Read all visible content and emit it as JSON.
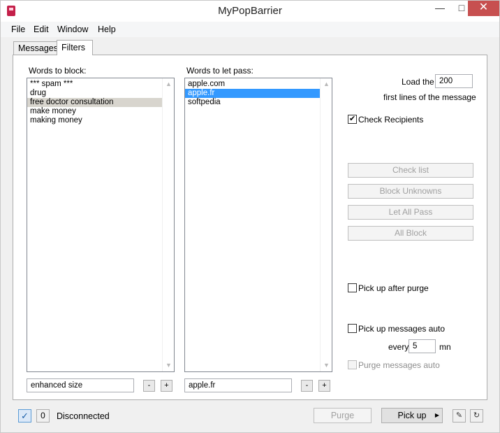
{
  "window": {
    "title": "MyPopBarrier"
  },
  "menu": {
    "file": "File",
    "edit": "Edit",
    "window": "Window",
    "help": "Help"
  },
  "tabs": {
    "messages": "Messages",
    "filters": "Filters",
    "active": "Filters"
  },
  "block": {
    "label": "Words to block:",
    "items": [
      "*** spam ***",
      "drug",
      "free doctor consultation",
      "make money",
      "making money"
    ],
    "selected_index": 2,
    "input_value": "enhanced size",
    "minus": "-",
    "plus": "+"
  },
  "pass": {
    "label": "Words to let pass:",
    "items": [
      "apple.com",
      "apple.fr",
      "softpedia"
    ],
    "selected_index": 1,
    "input_value": "apple.fr",
    "minus": "-",
    "plus": "+"
  },
  "options": {
    "load_the": "Load the",
    "load_lines": "200",
    "first_lines": "first lines of the message",
    "check_recipients": "Check Recipients",
    "check_recipients_checked": true,
    "check_list": "Check list",
    "block_unknowns": "Block Unknowns",
    "let_all_pass": "Let All Pass",
    "all_block": "All Block",
    "pickup_after_purge": "Pick up after purge",
    "pickup_after_purge_checked": false,
    "pickup_auto": "Pick up messages auto",
    "pickup_auto_checked": false,
    "every": "every",
    "every_value": "5",
    "mn": "mn",
    "purge_auto": "Purge messages auto",
    "purge_auto_checked": false
  },
  "status": {
    "count": "0",
    "connection": "Disconnected",
    "purge": "Purge",
    "pickup": "Pick up"
  },
  "colors": {
    "selection_blue": "#3399ff",
    "selection_gray": "#d8d5ce",
    "close_red": "#c75050"
  },
  "icons": [
    "app-icon",
    "minimize-icon",
    "maximize-icon",
    "close-icon",
    "check-icon",
    "dropdown-caret-icon",
    "write-icon",
    "refresh-icon"
  ]
}
